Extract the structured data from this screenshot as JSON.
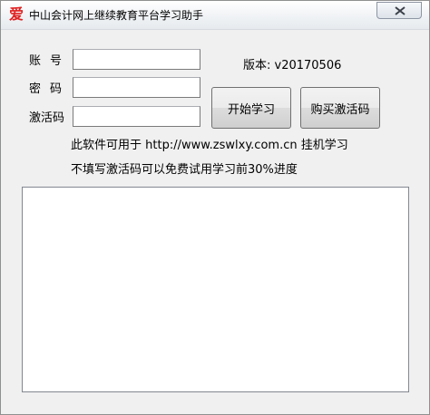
{
  "window": {
    "title": "中山会计网上继续教育平台学习助手",
    "icon_glyph": "爱",
    "icon_color": "#e02020"
  },
  "form": {
    "account_label": "账号",
    "password_label": "密码",
    "activation_label": "激活码",
    "account_value": "",
    "password_value": "",
    "activation_value": ""
  },
  "version_text": "版本: v20170506",
  "buttons": {
    "start_label": "开始学习",
    "buy_label": "购买激活码"
  },
  "info": {
    "line1": "此软件可用于 http://www.zswlxy.com.cn 挂机学习",
    "line2": "不填写激活码可以免费试用学习前30%进度"
  },
  "log": {
    "content": ""
  }
}
